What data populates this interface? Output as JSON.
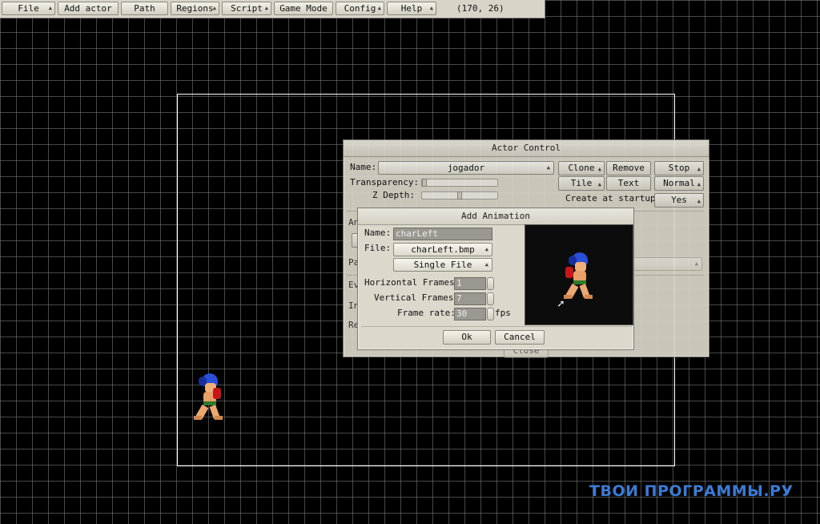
{
  "menubar": {
    "items": [
      "File",
      "Add actor",
      "Path",
      "Regions",
      "Script",
      "Game Mode",
      "Config",
      "Help"
    ],
    "coordinates": "(170, 26)"
  },
  "actor_control": {
    "title": "Actor Control",
    "name_label": "Name:",
    "name_value": "jogador",
    "transparency_label": "Transparency:",
    "zdepth_label": "Z Depth:",
    "transparency_value": 0.0,
    "zdepth_value": 0.5,
    "buttons": {
      "clone": "Clone",
      "remove": "Remove",
      "stop": "Stop",
      "tile": "Tile",
      "text": "Text",
      "normal": "Normal",
      "yes": "Yes"
    },
    "create_startup_label": "Create at startup:",
    "partial": {
      "an": "An",
      "pa": "Pa",
      "ev": "Ev",
      "in": "In",
      "re": "Re",
      "close": "Close"
    }
  },
  "add_animation": {
    "title": "Add Animation",
    "name_label": "Name:",
    "name_value": "charLeft",
    "file_label": "File:",
    "file_value": "charLeft.bmp",
    "mode_value": "Single File",
    "hframes_label": "Horizontal Frames:",
    "hframes_value": "1",
    "vframes_label": "Vertical Frames:",
    "vframes_value": "7",
    "framerate_label": "Frame rate:",
    "framerate_value": "30",
    "fps_label": "fps",
    "ok_label": "Ok",
    "cancel_label": "Cancel"
  },
  "watermark": "ТВОИ ПРОГРАММЫ.РУ",
  "colors": {
    "background": "#000000",
    "grid": "#828282",
    "window": "#d9d5c8",
    "watermark": "#3a7bd5"
  }
}
